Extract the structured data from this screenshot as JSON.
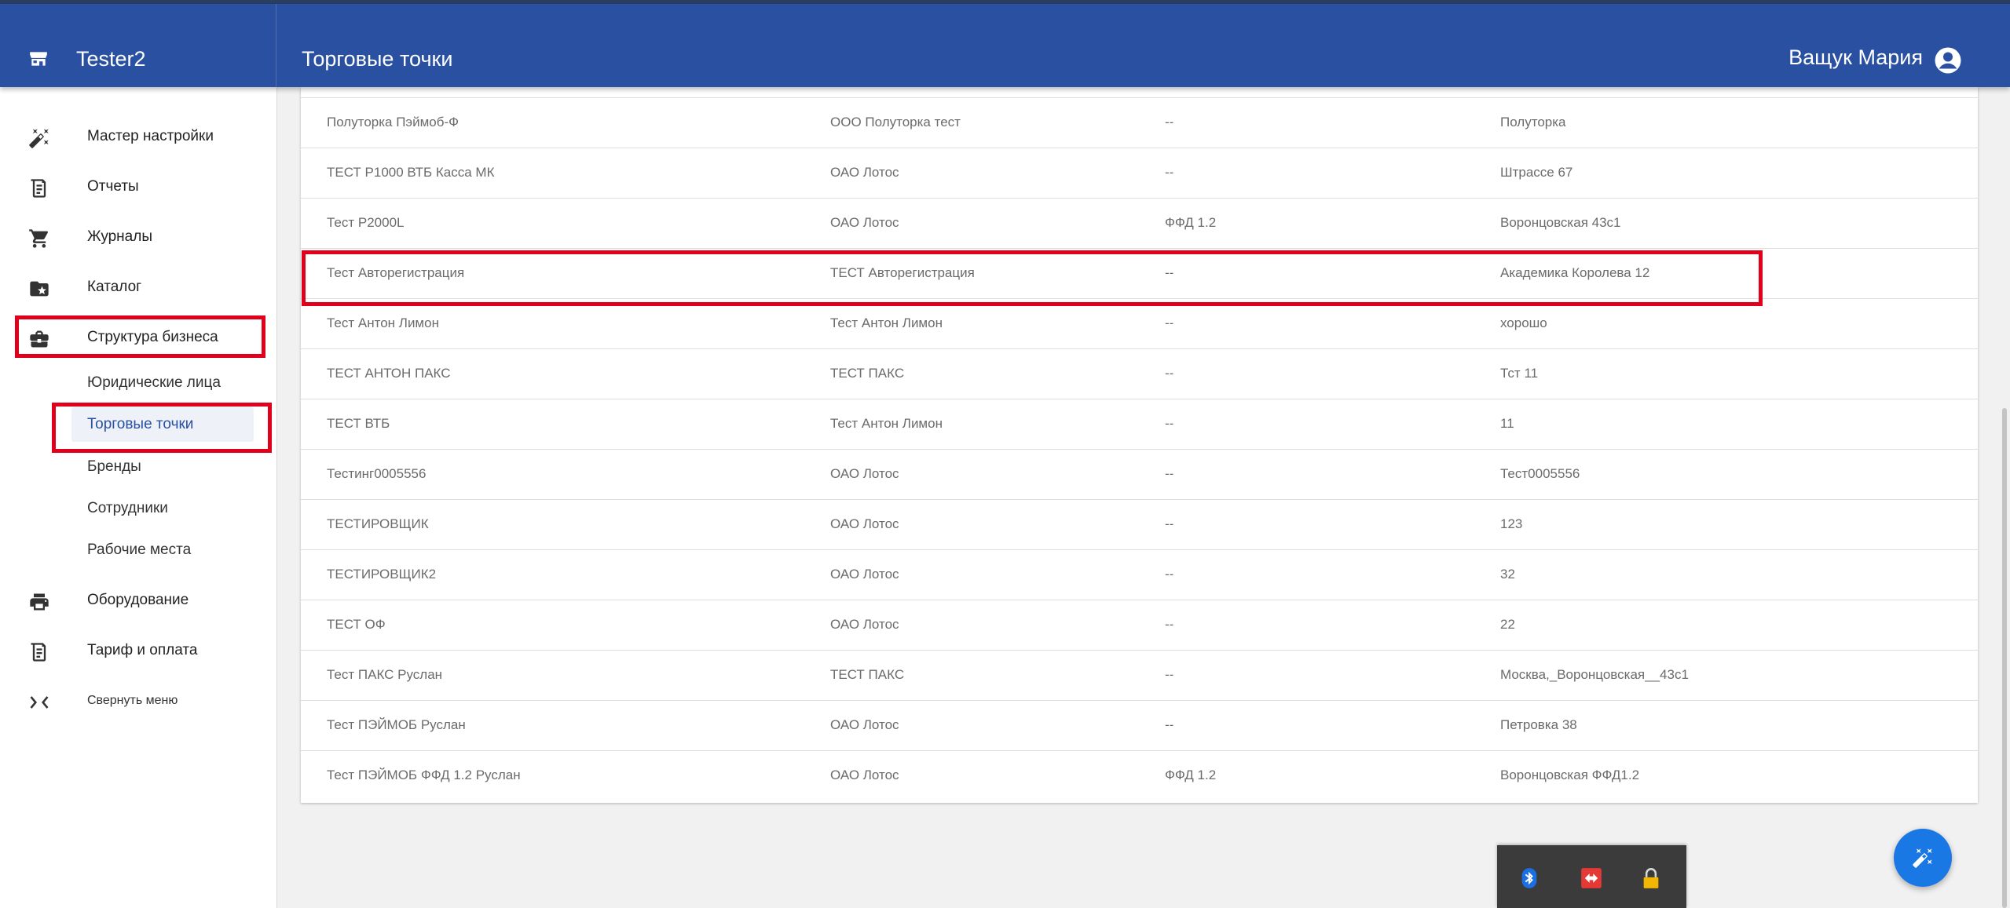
{
  "app": {
    "name": "Tester2"
  },
  "header": {
    "title": "Торговые точки",
    "user_name": "Ващук Мария"
  },
  "sidebar": {
    "items": [
      {
        "label": "Мастер настройки",
        "icon": "magic-wand-icon"
      },
      {
        "label": "Отчеты",
        "icon": "receipt-icon"
      },
      {
        "label": "Журналы",
        "icon": "cart-icon"
      },
      {
        "label": "Каталог",
        "icon": "folder-star-icon"
      },
      {
        "label": "Структура бизнеса",
        "icon": "briefcase-icon"
      },
      {
        "label": "Оборудование",
        "icon": "printer-icon"
      },
      {
        "label": "Тариф и оплата",
        "icon": "invoice-icon"
      },
      {
        "label": "Свернуть меню",
        "icon": "collapse-icon"
      }
    ],
    "subitems": [
      {
        "label": "Юридические лица"
      },
      {
        "label": "Торговые точки"
      },
      {
        "label": "Бренды"
      },
      {
        "label": "Сотрудники"
      },
      {
        "label": "Рабочие места"
      }
    ],
    "active_subitem": "Торговые точки"
  },
  "table": {
    "rows": [
      [
        "Полуторка Пэймоб-Ф",
        "ООО Полуторка тест",
        "--",
        "Полуторка"
      ],
      [
        "ТЕСТ P1000 ВТБ Касса МК",
        "ОАО Лотос",
        "--",
        "Штрассе 67"
      ],
      [
        "Тест P2000L",
        "ОАО Лотос",
        "ФФД 1.2",
        "Воронцовская 43с1"
      ],
      [
        "Тест Авторегистрация",
        "ТЕСТ Авторегистрация",
        "--",
        "Академика Королева 12"
      ],
      [
        "Тест Антон Лимон",
        "Тест Антон Лимон",
        "--",
        "хорошо"
      ],
      [
        "ТЕСТ АНТОН ПАКС",
        "ТЕСТ ПАКС",
        "--",
        "Тст 11"
      ],
      [
        "ТЕСТ ВТБ",
        "Тест Антон Лимон",
        "--",
        "11"
      ],
      [
        "Тестинг0005556",
        "ОАО Лотос",
        "--",
        "Тест0005556"
      ],
      [
        "ТЕСТИРОВЩИК",
        "ОАО Лотос",
        "--",
        "123"
      ],
      [
        "ТЕСТИРОВЩИК2",
        "ОАО Лотос",
        "--",
        "32"
      ],
      [
        "ТЕСТ ОФ",
        "ОАО Лотос",
        "--",
        "22"
      ],
      [
        "Тест ПАКС Руслан",
        "ТЕСТ ПАКС",
        "--",
        "Москва,_Воронцовская__43с1"
      ],
      [
        "Тест ПЭЙМОБ Руслан",
        "ОАО Лотос",
        "--",
        "Петровка 38"
      ],
      [
        "Тест ПЭЙМОБ ФФД 1.2 Руслан",
        "ОАО Лотос",
        "ФФД 1.2",
        "Воронцовская ФФД1.2"
      ]
    ]
  },
  "tray": {
    "icons": [
      "bluetooth-icon",
      "remote-desktop-icon",
      "lock-icon"
    ]
  },
  "colors": {
    "appbar": "#2a50a2",
    "highlight": "#e0001b",
    "fab": "#1a78e5"
  }
}
